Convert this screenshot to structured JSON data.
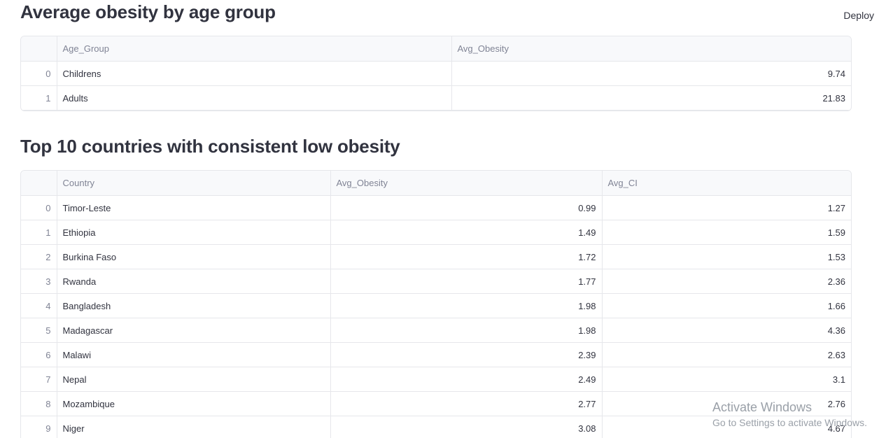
{
  "header": {
    "deploy_label": "Deploy"
  },
  "section1": {
    "title": "Average obesity by age group",
    "columns": [
      "",
      "Age_Group",
      "Avg_Obesity"
    ],
    "rows": [
      {
        "index": "0",
        "age_group": "Childrens",
        "avg_obesity": "9.74"
      },
      {
        "index": "1",
        "age_group": "Adults",
        "avg_obesity": "21.83"
      }
    ]
  },
  "section2": {
    "title": "Top 10 countries with consistent low obesity",
    "columns": [
      "",
      "Country",
      "Avg_Obesity",
      "Avg_CI"
    ],
    "rows": [
      {
        "index": "0",
        "country": "Timor-Leste",
        "avg_obesity": "0.99",
        "avg_ci": "1.27"
      },
      {
        "index": "1",
        "country": "Ethiopia",
        "avg_obesity": "1.49",
        "avg_ci": "1.59"
      },
      {
        "index": "2",
        "country": "Burkina Faso",
        "avg_obesity": "1.72",
        "avg_ci": "1.53"
      },
      {
        "index": "3",
        "country": "Rwanda",
        "avg_obesity": "1.77",
        "avg_ci": "2.36"
      },
      {
        "index": "4",
        "country": "Bangladesh",
        "avg_obesity": "1.98",
        "avg_ci": "1.66"
      },
      {
        "index": "5",
        "country": "Madagascar",
        "avg_obesity": "1.98",
        "avg_ci": "4.36"
      },
      {
        "index": "6",
        "country": "Malawi",
        "avg_obesity": "2.39",
        "avg_ci": "2.63"
      },
      {
        "index": "7",
        "country": "Nepal",
        "avg_obesity": "2.49",
        "avg_ci": "3.1"
      },
      {
        "index": "8",
        "country": "Mozambique",
        "avg_obesity": "2.77",
        "avg_ci": "2.76"
      },
      {
        "index": "9",
        "country": "Niger",
        "avg_obesity": "3.08",
        "avg_ci": "4.67"
      }
    ]
  },
  "watermark": {
    "title": "Activate Windows",
    "subtitle": "Go to Settings to activate Windows."
  }
}
